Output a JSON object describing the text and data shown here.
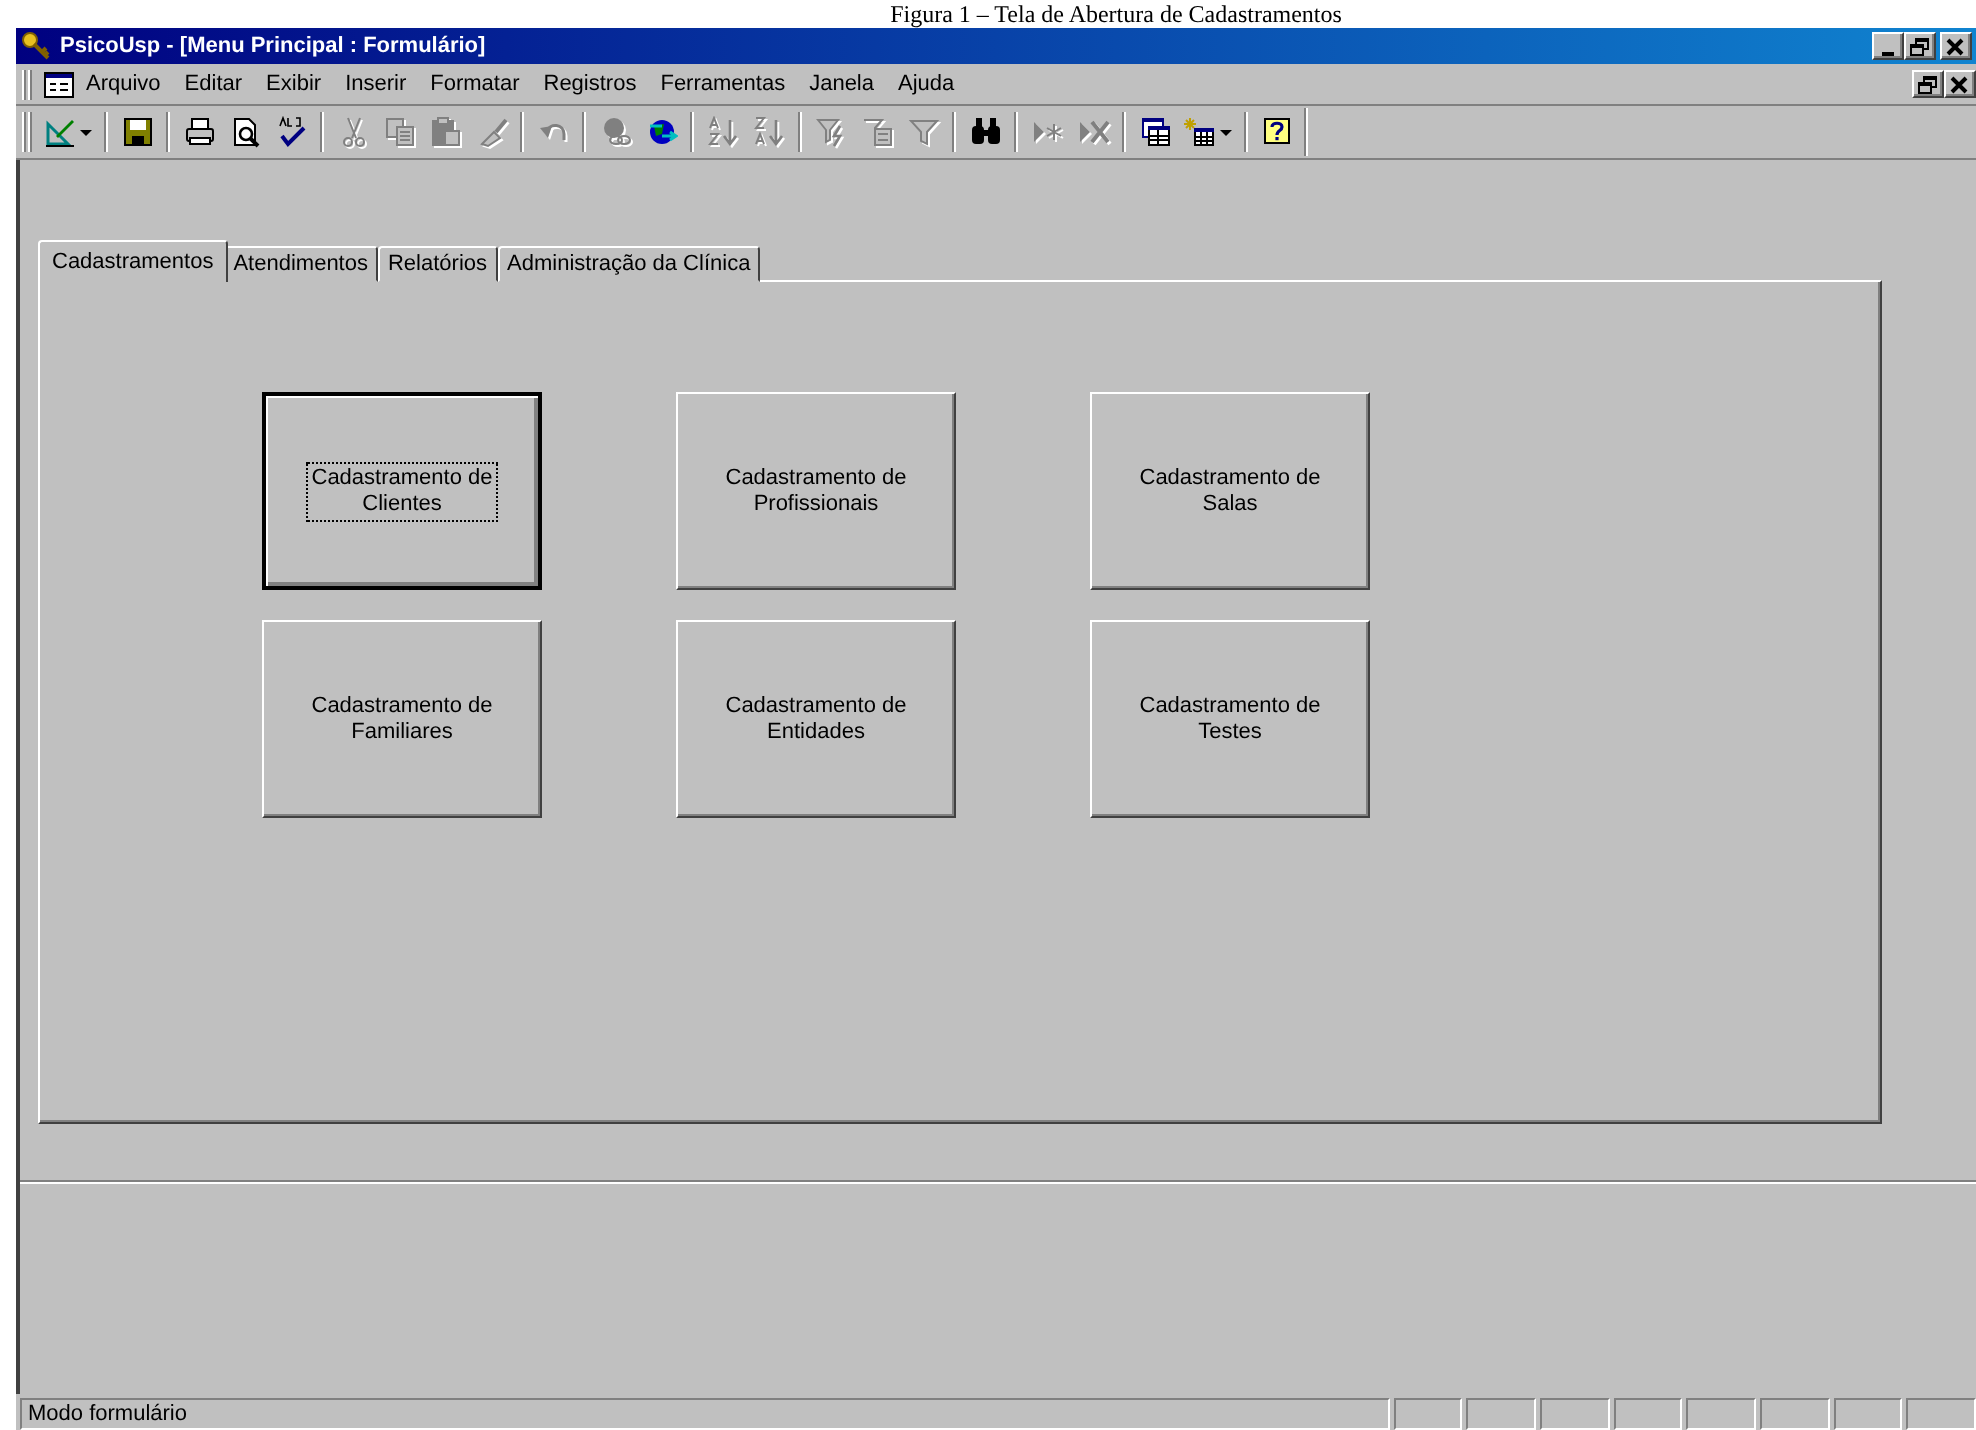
{
  "caption": "Figura 1 – Tela de Abertura de Cadastramentos",
  "window": {
    "title": "PsicoUsp - [Menu Principal : Formulário]"
  },
  "menu": [
    "Arquivo",
    "Editar",
    "Exibir",
    "Inserir",
    "Formatar",
    "Registros",
    "Ferramentas",
    "Janela",
    "Ajuda"
  ],
  "toolbar": {
    "groups": [
      [
        {
          "kind": "design",
          "disabled": false
        }
      ],
      [
        {
          "kind": "save",
          "disabled": false
        }
      ],
      [
        {
          "kind": "print",
          "disabled": false
        },
        {
          "kind": "preview",
          "disabled": false
        },
        {
          "kind": "spelling",
          "disabled": false
        }
      ],
      [
        {
          "kind": "cut",
          "disabled": true
        },
        {
          "kind": "copy",
          "disabled": true
        },
        {
          "kind": "paste",
          "disabled": true
        },
        {
          "kind": "brush",
          "disabled": true
        }
      ],
      [
        {
          "kind": "undo",
          "disabled": true
        }
      ],
      [
        {
          "kind": "globe-link",
          "disabled": true
        },
        {
          "kind": "globe",
          "disabled": false
        }
      ],
      [
        {
          "kind": "sort-asc",
          "disabled": true
        },
        {
          "kind": "sort-desc",
          "disabled": true
        }
      ],
      [
        {
          "kind": "filter-lightning",
          "disabled": true
        },
        {
          "kind": "filter-form",
          "disabled": true
        },
        {
          "kind": "filter",
          "disabled": true
        }
      ],
      [
        {
          "kind": "binoculars",
          "disabled": false
        }
      ],
      [
        {
          "kind": "new-record",
          "disabled": true
        },
        {
          "kind": "delete-record",
          "disabled": true
        }
      ],
      [
        {
          "kind": "windows",
          "disabled": false
        },
        {
          "kind": "new-table",
          "disabled": false
        }
      ],
      [
        {
          "kind": "help",
          "disabled": false
        }
      ]
    ]
  },
  "tabs": [
    {
      "label": "Cadastramentos",
      "selected": true
    },
    {
      "label": "Atendimentos",
      "selected": false
    },
    {
      "label": "Relatórios",
      "selected": false
    },
    {
      "label": "Administração da Clínica",
      "selected": false
    }
  ],
  "buttons": [
    {
      "label": "Cadastramento de\nClientes",
      "focused": true
    },
    {
      "label": "Cadastramento de\nProfissionais",
      "focused": false
    },
    {
      "label": "Cadastramento de\nSalas",
      "focused": false
    },
    {
      "label": "Cadastramento de\nFamiliares",
      "focused": false
    },
    {
      "label": "Cadastramento de\nEntidades",
      "focused": false
    },
    {
      "label": "Cadastramento de\nTestes",
      "focused": false
    }
  ],
  "status": {
    "text": "Modo formulário"
  }
}
